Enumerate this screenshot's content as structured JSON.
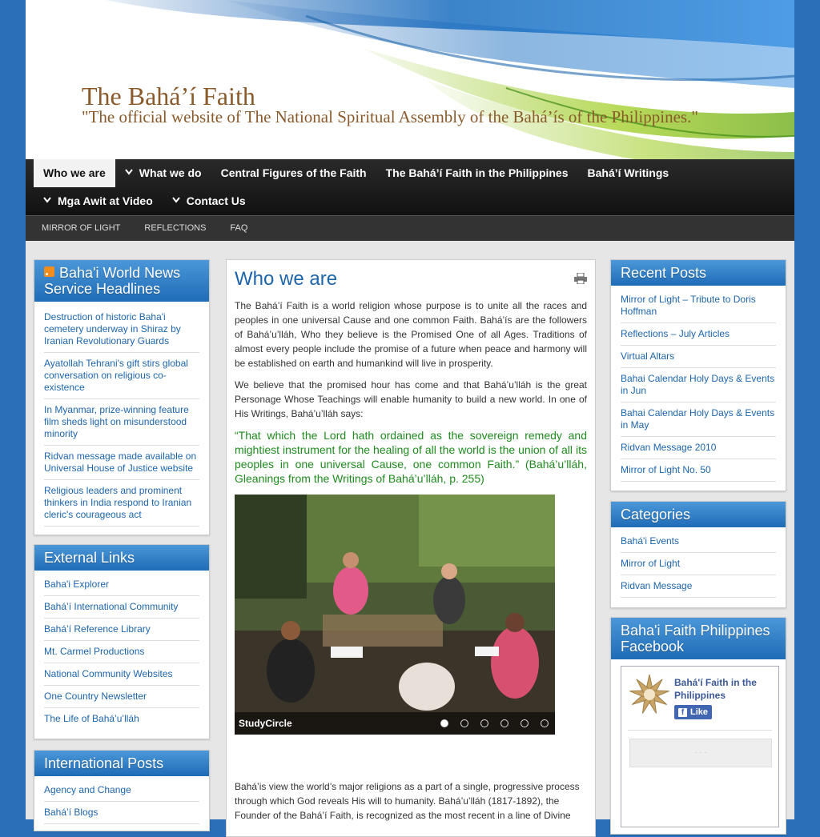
{
  "header": {
    "title": "The Bahá’í Faith",
    "tagline": "\"The official website of The National Spiritual Assembly of the Bahá’ís of the Philippines.\""
  },
  "nav": {
    "row1": [
      {
        "label": "Who we are",
        "active": true,
        "dropdown": false
      },
      {
        "label": "What we do",
        "active": false,
        "dropdown": true
      },
      {
        "label": "Central Figures of the Faith",
        "active": false,
        "dropdown": false
      },
      {
        "label": "The Bahá’í Faith in the Philippines",
        "active": false,
        "dropdown": false
      },
      {
        "label": "Bahá’í Writings",
        "active": false,
        "dropdown": false
      }
    ],
    "row2": [
      {
        "label": "Mga Awit at Video",
        "dropdown": true
      },
      {
        "label": "Contact Us",
        "dropdown": true
      }
    ]
  },
  "subnav": [
    "MIRROR OF LIGHT",
    "REFLECTIONS",
    "FAQ"
  ],
  "left": {
    "news": {
      "title": "Baha'i World News Service Headlines",
      "items": [
        "Destruction of historic Baha'i cemetery underway in Shiraz by Iranian Revolutionary Guards",
        "Ayatollah Tehrani's gift stirs global conversation on religious co-existence",
        "In Myanmar, prize-winning feature film sheds light on misunderstood minority",
        "Ridvan message made available on Universal House of Justice website",
        "Religious leaders and prominent thinkers in India respond to Iranian cleric's courageous act"
      ]
    },
    "links": {
      "title": "External Links",
      "items": [
        "Baha'i Explorer",
        "Bahá’í International Community",
        "Bahá’í Reference Library",
        "Mt. Carmel Productions",
        "National Community Websites",
        "One Country Newsletter",
        "The Life of Bahá’u’lláh"
      ]
    },
    "intl": {
      "title": "International Posts",
      "items": [
        "Agency and Change",
        "Bahá’í Blogs"
      ]
    }
  },
  "main": {
    "title": "Who we are",
    "p1": "The Bahá’í Faith is a world religion whose purpose is to unite all the races and peoples in one universal Cause and one common Faith. Bahá’ís are the followers of Bahá’u’lláh, Who they believe is the Promised One of all Ages. Traditions of almost every people include the promise of a future when peace and harmony will be established on earth and humankind will live in prosperity.",
    "p2": "We believe that the promised hour has come and that Bahá’u’lláh is the great Personage Whose Teachings will enable humanity to build a new world. In one of His Writings, Bahá’u’lláh says:",
    "quote": "“That which the Lord hath ordained as the sovereign remedy and mightiest instrument for the healing of all the world is the union of all its peoples in one universal Cause, one common Faith.” (Bahá’u’lláh, Gleanings from the Writings of Bahá’u’lláh, p. 255)",
    "slide_caption": "StudyCircle",
    "slide_count": 6,
    "slide_active": 1,
    "p3": "Bahá’is view the world’s major religions as a part of a single, progressive process through which God reveals His will to humanity. Bahá’u’lláh (1817-1892), the Founder of the Bahá’í Faith, is recognized as the most recent in a line of Divine"
  },
  "right": {
    "recent": {
      "title": "Recent Posts",
      "items": [
        "Mirror of Light – Tribute to Doris Hoffman",
        "Reflections – July Articles",
        "Virtual Altars",
        "Bahai Calendar Holy Days & Events in Jun",
        "Bahai Calendar Holy Days & Events in May",
        "Ridvan Message 2010",
        "Mirror of Light No. 50"
      ]
    },
    "categories": {
      "title": "Categories",
      "items": [
        "Bahá'i Events",
        "Mirror of Light",
        "Ridvan Message"
      ]
    },
    "facebook": {
      "title": "Baha'i Faith Philippines Facebook",
      "page_name": "Bahá'í Faith in the Philippines",
      "like_label": "Like",
      "loading": "· · ·"
    }
  },
  "colors": {
    "accent": "#1d65ac",
    "quote": "#1e8b1e",
    "title_brown": "#8a5a2b"
  }
}
